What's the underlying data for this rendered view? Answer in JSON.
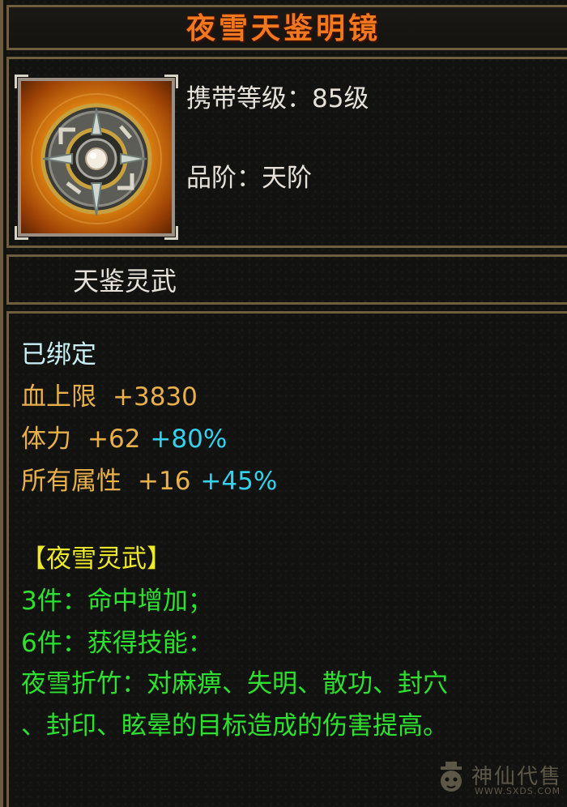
{
  "item": {
    "name": "夜雪天鉴明镜",
    "level_label": "携带等级：85级",
    "grade_label": "品阶：天阶",
    "subtitle": "天鉴灵武"
  },
  "stats": {
    "bound": "已绑定",
    "hp": {
      "label": "血上限",
      "value": "+3830"
    },
    "stamina": {
      "label": "体力",
      "value": "+62",
      "bonus": "+80%"
    },
    "all_attr": {
      "label": "所有属性",
      "value": "+16",
      "bonus": "+45%"
    }
  },
  "set": {
    "name": "【夜雪灵武】",
    "piece3": "3件：命中增加；",
    "piece6": "6件：获得技能：",
    "skill_line1": "夜雪折竹：对麻痹、失明、散功、封穴",
    "skill_line2": "、封印、眩晕的目标造成的伤害提高。"
  },
  "watermark": {
    "name": "神仙代售",
    "url": "WWW.SXDS.COM"
  },
  "icons": {
    "item_icon": "mirror-disc-icon",
    "watermark_logo": "cat-mascot-icon"
  },
  "colors": {
    "title": "#f2781e",
    "attribute": "#e9b04a",
    "bonus": "#33d2ee",
    "set_name": "#eeea2a",
    "set_effect": "#2de12f",
    "bound": "#c8f0f6"
  }
}
